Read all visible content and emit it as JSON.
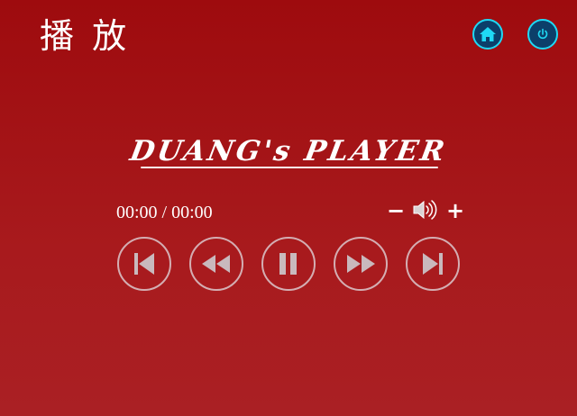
{
  "header": {
    "title": "播 放"
  },
  "player": {
    "title": "DUANG's PLAYER",
    "time": "00:00 / 00:00",
    "volume_minus": "−",
    "volume_plus": "+"
  },
  "icons": {
    "home": "home-icon",
    "power": "power-icon",
    "speaker": "speaker-icon",
    "first": "skip-to-start-icon",
    "rewind": "rewind-icon",
    "pause": "pause-icon",
    "forward": "fast-forward-icon",
    "last": "skip-to-end-icon"
  },
  "colors": {
    "background_top": "#9e0b0e",
    "background_bottom": "#aa2024",
    "accent": "#1fd9f4",
    "control_icon": "#c9b9bd"
  }
}
